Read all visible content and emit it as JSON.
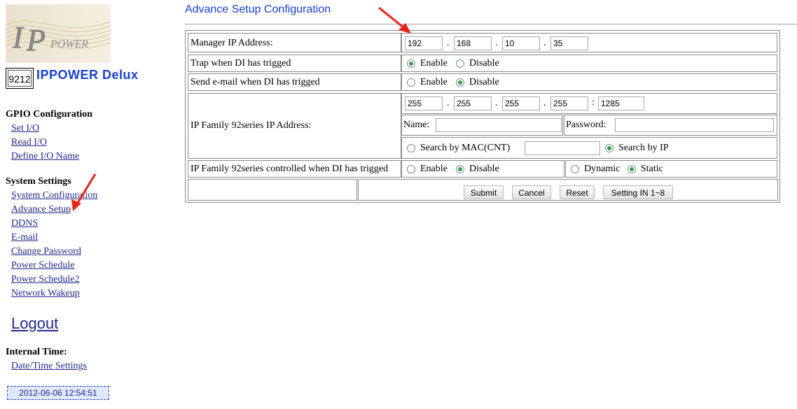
{
  "sidebar": {
    "logo_text": "IPPOWER",
    "model_number": "9212",
    "model_name": "IPPOWER Delux",
    "gpio_heading": "GPIO Configuration",
    "gpio_links": [
      "Set I/O",
      "Read I/O",
      "Define I/O Name"
    ],
    "system_heading": "System Settings",
    "system_links": [
      "System Configuration",
      "Advance Setup",
      "DDNS",
      "E-mail",
      "Change Password",
      "Power Schedule",
      "Power Schedule2",
      "Network Wakeup"
    ],
    "logout_label": "Logout",
    "time_heading": "Internal Time:",
    "time_link": "Date/Time Settings",
    "clock_value": "2012-06-06 12:54:51"
  },
  "main": {
    "title": "Advance Setup Configuration",
    "manager_ip": {
      "label": "Manager IP Address:",
      "octets": [
        "192",
        "168",
        "10",
        "35"
      ],
      "dot": "."
    },
    "trap_di": {
      "label": "Trap when DI has trigged",
      "enable_label": "Enable",
      "disable_label": "Disable",
      "selected": "enable"
    },
    "email_di": {
      "label": "Send e-mail when DI has trigged",
      "enable_label": "Enable",
      "disable_label": "Disable",
      "selected": "disable"
    },
    "family_ip": {
      "label": "IP Family 92series IP Address:",
      "octets": [
        "255",
        "255",
        "255",
        "255"
      ],
      "dot": ".",
      "colon": ":",
      "port": "1285",
      "name_label": "Name:",
      "name_value": "",
      "password_label": "Password:",
      "password_value": "",
      "search_mac_label": "Search by MAC(CNT)",
      "mac_value": "",
      "search_ip_label": "Search by IP",
      "search_selected": "ip"
    },
    "family_control": {
      "label": "IP Family 92series controlled when DI has trigged",
      "enable_label": "Enable",
      "disable_label": "Disable",
      "selected": "disable",
      "dynamic_label": "Dynamic",
      "static_label": "Static",
      "mode_selected": "static"
    },
    "buttons": {
      "submit": "Submit",
      "cancel": "Cancel",
      "reset": "Reset",
      "setting": "Setting IN 1~8"
    }
  },
  "colors": {
    "link": "#1f2a8a",
    "title": "#1a3fd6",
    "radio_selected": "#3a9a4a",
    "annotation_arrow": "#e8231a"
  }
}
